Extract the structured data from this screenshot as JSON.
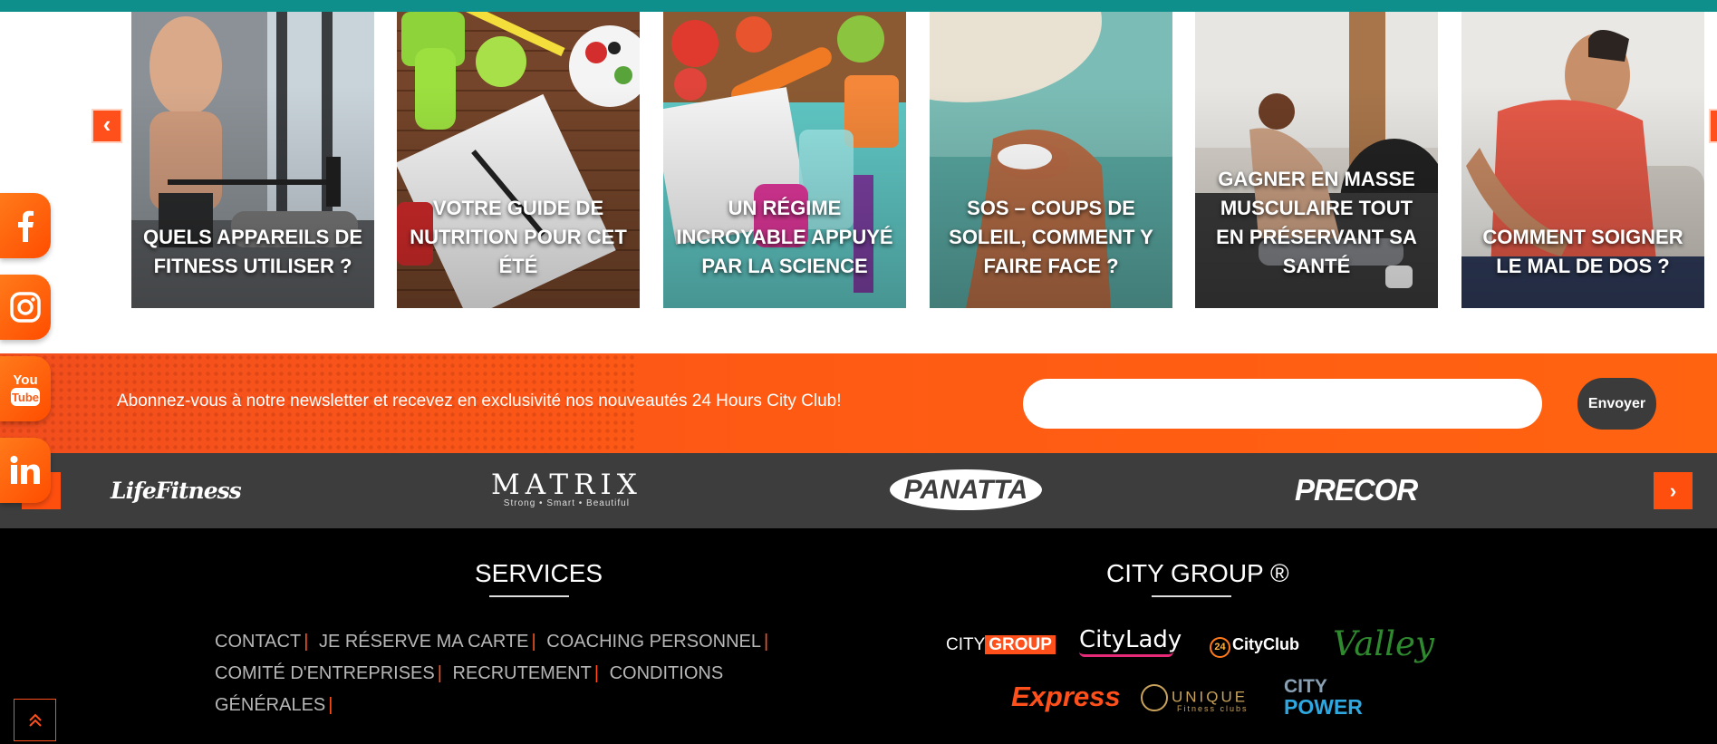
{
  "carousel": {
    "prev_glyph": "‹",
    "next_glyph": "›",
    "cards": [
      {
        "title": "QUELS APPAREILS DE FITNESS UTILISER ?"
      },
      {
        "title": "VOTRE GUIDE DE NUTRITION POUR CET ÉTÉ"
      },
      {
        "title": "UN RÉGIME INCROYABLE APPUYÉ PAR LA SCIENCE"
      },
      {
        "title": "SOS – COUPS DE SOLEIL, COMMENT Y FAIRE FACE ?"
      },
      {
        "title": "GAGNER EN MASSE MUSCULAIRE TOUT EN PRÉSERVANT SA SANTÉ"
      },
      {
        "title": "COMMENT SOIGNER LE MAL DE DOS ?"
      }
    ]
  },
  "social": {
    "facebook": "facebook-icon",
    "instagram": "instagram-icon",
    "youtube": "youtube-icon",
    "linkedin": "linkedin-icon"
  },
  "newsletter": {
    "text": "Abonnez-vous à notre newsletter et recevez en exclusivité nos nouveautés 24 Hours City Club!",
    "email_value": "",
    "send_label": "Envoyer"
  },
  "brands": {
    "prev_glyph": "‹",
    "next_glyph": "›",
    "items": [
      {
        "name": "LifeFitness"
      },
      {
        "name": "MATRIX",
        "tagline": "Strong • Smart • Beautiful"
      },
      {
        "name": "PANATTA"
      },
      {
        "name": "PRECOR"
      }
    ]
  },
  "footer": {
    "services_title": "SERVICES",
    "group_title": "CITY GROUP ®",
    "links": [
      "CONTACT",
      "JE RÉSERVE MA CARTE",
      "COACHING PERSONNEL",
      "COMITÉ D'ENTREPRISES",
      "RECRUTEMENT",
      "CONDITIONS GÉNÉRALES"
    ],
    "separator": "|",
    "logos": {
      "citygroup_city": "CITY",
      "citygroup_group": "GROUP",
      "citylady": "CityLady",
      "cityclub_num": "24",
      "cityclub": "CityClub",
      "valley": "Valley",
      "express": "Express",
      "unique": "UNIQUE",
      "unique_sub": "Fitness clubs",
      "citypower_city": "CITY",
      "citypower_power": "POWER"
    }
  },
  "colors": {
    "accent": "#ff4f1a",
    "teal": "#0f8f8c",
    "dark_strip": "#3e3d3d",
    "footer": "#000000"
  }
}
